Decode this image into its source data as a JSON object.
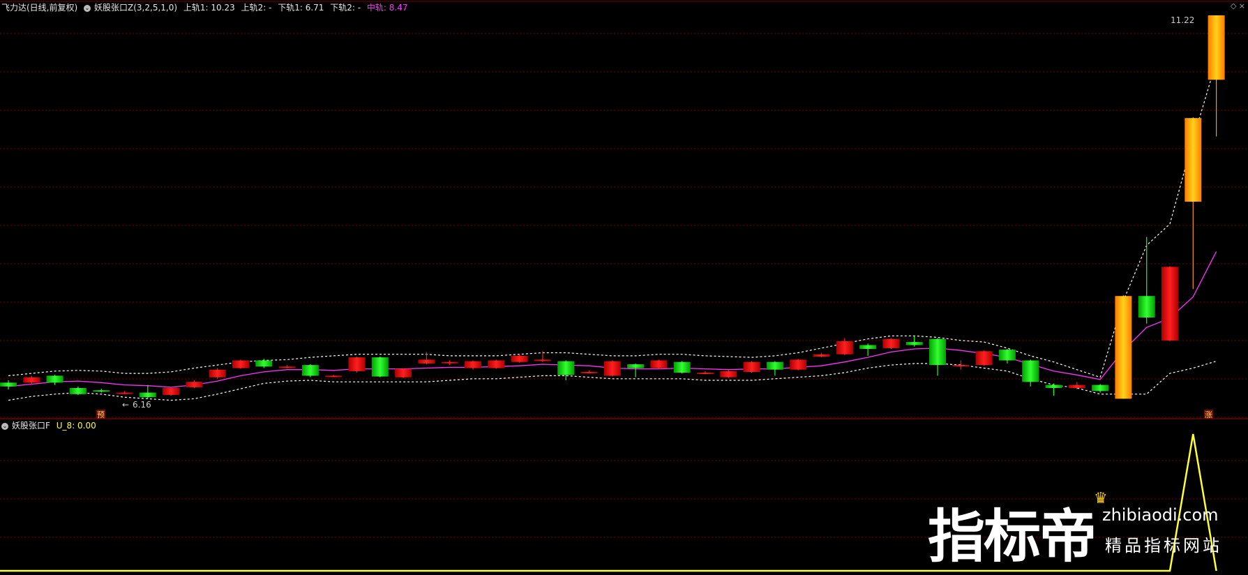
{
  "main_header": {
    "stock_name": "飞力达(日线,前复权)",
    "indicator_name": "妖股张口Z(3,2,5,1,0)",
    "upper1": "上轨1: 10.23",
    "upper2": "上轨2: -",
    "lower1": "下轨1: 6.71",
    "lower2": "下轨2: -",
    "mid": "中轨: 8.47"
  },
  "sub_header": {
    "indicator_name": "妖股张口F",
    "value": "U_8: 0.00"
  },
  "annotations": {
    "high_label": "11.22",
    "low_label": "6.16",
    "marker_left": "预",
    "marker_right": "涨"
  },
  "watermark": {
    "brand": "指标帝",
    "url": "zhibiaodi.com",
    "tagline": "精品指标网站"
  },
  "colors": {
    "up": "#ff1a1a",
    "down": "#1aff1a",
    "highlight": "#ff9900",
    "mid_line": "#ff33ff",
    "band_line": "#ffffff",
    "sub_line": "#ffff33",
    "grid": "#7a0000"
  },
  "chart_data": {
    "type": "candlestick",
    "price_range": [
      6.0,
      11.3
    ],
    "candles": [
      {
        "o": 6.43,
        "c": 6.38,
        "h": 6.46,
        "l": 6.34,
        "d": "down"
      },
      {
        "o": 6.43,
        "c": 6.5,
        "h": 6.52,
        "l": 6.4,
        "d": "up"
      },
      {
        "o": 6.43,
        "c": 6.52,
        "h": 6.53,
        "l": 6.4,
        "d": "down"
      },
      {
        "o": 6.36,
        "c": 6.28,
        "h": 6.38,
        "l": 6.27,
        "d": "down"
      },
      {
        "o": 6.33,
        "c": 6.33,
        "h": 6.35,
        "l": 6.3,
        "d": "down"
      },
      {
        "o": 6.3,
        "c": 6.3,
        "h": 6.32,
        "l": 6.28,
        "d": "up"
      },
      {
        "o": 6.3,
        "c": 6.24,
        "h": 6.4,
        "l": 6.22,
        "d": "down"
      },
      {
        "o": 6.27,
        "c": 6.36,
        "h": 6.37,
        "l": 6.26,
        "d": "up"
      },
      {
        "o": 6.37,
        "c": 6.44,
        "h": 6.46,
        "l": 6.36,
        "d": "up"
      },
      {
        "o": 6.5,
        "c": 6.6,
        "h": 6.62,
        "l": 6.48,
        "d": "up"
      },
      {
        "o": 6.62,
        "c": 6.72,
        "h": 6.73,
        "l": 6.61,
        "d": "up"
      },
      {
        "o": 6.72,
        "c": 6.64,
        "h": 6.74,
        "l": 6.62,
        "d": "down"
      },
      {
        "o": 6.64,
        "c": 6.64,
        "h": 6.66,
        "l": 6.62,
        "d": "up"
      },
      {
        "o": 6.66,
        "c": 6.52,
        "h": 6.67,
        "l": 6.5,
        "d": "down"
      },
      {
        "o": 6.52,
        "c": 6.52,
        "h": 6.53,
        "l": 6.51,
        "d": "up"
      },
      {
        "o": 6.58,
        "c": 6.76,
        "h": 6.77,
        "l": 6.56,
        "d": "up"
      },
      {
        "o": 6.76,
        "c": 6.51,
        "h": 6.77,
        "l": 6.5,
        "d": "down"
      },
      {
        "o": 6.5,
        "c": 6.61,
        "h": 6.62,
        "l": 6.49,
        "d": "up"
      },
      {
        "o": 6.68,
        "c": 6.73,
        "h": 6.83,
        "l": 6.67,
        "d": "up"
      },
      {
        "o": 6.7,
        "c": 6.7,
        "h": 6.72,
        "l": 6.66,
        "d": "up"
      },
      {
        "o": 6.62,
        "c": 6.71,
        "h": 6.72,
        "l": 6.6,
        "d": "up"
      },
      {
        "o": 6.62,
        "c": 6.72,
        "h": 6.73,
        "l": 6.61,
        "d": "up"
      },
      {
        "o": 6.7,
        "c": 6.78,
        "h": 6.8,
        "l": 6.69,
        "d": "up"
      },
      {
        "o": 6.73,
        "c": 6.73,
        "h": 6.84,
        "l": 6.7,
        "d": "up"
      },
      {
        "o": 6.71,
        "c": 6.53,
        "h": 6.72,
        "l": 6.46,
        "d": "down"
      },
      {
        "o": 6.57,
        "c": 6.57,
        "h": 6.59,
        "l": 6.55,
        "d": "up"
      },
      {
        "o": 6.52,
        "c": 6.71,
        "h": 6.72,
        "l": 6.51,
        "d": "up"
      },
      {
        "o": 6.67,
        "c": 6.62,
        "h": 6.68,
        "l": 6.5,
        "d": "down"
      },
      {
        "o": 6.62,
        "c": 6.72,
        "h": 6.73,
        "l": 6.61,
        "d": "up"
      },
      {
        "o": 6.7,
        "c": 6.56,
        "h": 6.71,
        "l": 6.55,
        "d": "down"
      },
      {
        "o": 6.56,
        "c": 6.56,
        "h": 6.58,
        "l": 6.54,
        "d": "up"
      },
      {
        "o": 6.5,
        "c": 6.58,
        "h": 6.59,
        "l": 6.49,
        "d": "up"
      },
      {
        "o": 6.57,
        "c": 6.7,
        "h": 6.71,
        "l": 6.56,
        "d": "up"
      },
      {
        "o": 6.7,
        "c": 6.6,
        "h": 6.71,
        "l": 6.52,
        "d": "down"
      },
      {
        "o": 6.6,
        "c": 6.73,
        "h": 6.74,
        "l": 6.59,
        "d": "up"
      },
      {
        "o": 6.77,
        "c": 6.8,
        "h": 6.82,
        "l": 6.76,
        "d": "up"
      },
      {
        "o": 6.8,
        "c": 6.97,
        "h": 7.01,
        "l": 6.79,
        "d": "up"
      },
      {
        "o": 6.87,
        "c": 6.92,
        "h": 6.94,
        "l": 6.78,
        "d": "down"
      },
      {
        "o": 6.88,
        "c": 7.0,
        "h": 7.01,
        "l": 6.87,
        "d": "up"
      },
      {
        "o": 6.96,
        "c": 6.92,
        "h": 7.04,
        "l": 6.9,
        "d": "down"
      },
      {
        "o": 7.0,
        "c": 6.66,
        "h": 7.01,
        "l": 6.52,
        "d": "down"
      },
      {
        "o": 6.66,
        "c": 6.66,
        "h": 6.72,
        "l": 6.6,
        "d": "up"
      },
      {
        "o": 6.66,
        "c": 6.84,
        "h": 6.85,
        "l": 6.65,
        "d": "up"
      },
      {
        "o": 6.86,
        "c": 6.72,
        "h": 6.87,
        "l": 6.68,
        "d": "down"
      },
      {
        "o": 6.72,
        "c": 6.44,
        "h": 6.73,
        "l": 6.38,
        "d": "down"
      },
      {
        "o": 6.4,
        "c": 6.36,
        "h": 6.42,
        "l": 6.26,
        "d": "down"
      },
      {
        "o": 6.36,
        "c": 6.4,
        "h": 6.44,
        "l": 6.34,
        "d": "up"
      },
      {
        "o": 6.4,
        "c": 6.32,
        "h": 6.41,
        "l": 6.3,
        "d": "down"
      },
      {
        "o": 6.22,
        "c": 7.56,
        "h": 7.57,
        "l": 6.22,
        "d": "hi"
      },
      {
        "o": 7.28,
        "c": 7.56,
        "h": 8.33,
        "l": 7.2,
        "d": "down"
      },
      {
        "o": 6.98,
        "c": 7.94,
        "h": 7.95,
        "l": 6.97,
        "d": "up"
      },
      {
        "o": 8.79,
        "c": 9.88,
        "h": 9.89,
        "l": 7.65,
        "d": "hi"
      },
      {
        "o": 10.38,
        "c": 11.22,
        "h": 11.22,
        "l": 9.64,
        "d": "hi"
      }
    ],
    "mid_line": [
      6.38,
      6.41,
      6.44,
      6.45,
      6.43,
      6.4,
      6.39,
      6.37,
      6.4,
      6.45,
      6.52,
      6.57,
      6.6,
      6.6,
      6.59,
      6.61,
      6.61,
      6.61,
      6.62,
      6.63,
      6.63,
      6.64,
      6.65,
      6.67,
      6.66,
      6.65,
      6.62,
      6.61,
      6.61,
      6.62,
      6.61,
      6.6,
      6.61,
      6.61,
      6.63,
      6.65,
      6.7,
      6.76,
      6.83,
      6.87,
      6.88,
      6.85,
      6.81,
      6.76,
      6.67,
      6.58,
      6.53,
      6.47,
      6.85,
      7.15,
      7.27,
      7.55,
      8.14
    ],
    "upper_band": [
      6.52,
      6.55,
      6.58,
      6.59,
      6.58,
      6.55,
      6.55,
      6.57,
      6.62,
      6.66,
      6.7,
      6.72,
      6.73,
      6.76,
      6.78,
      6.8,
      6.8,
      6.8,
      6.8,
      6.78,
      6.78,
      6.78,
      6.8,
      6.82,
      6.82,
      6.8,
      6.78,
      6.78,
      6.8,
      6.8,
      6.78,
      6.77,
      6.76,
      6.78,
      6.82,
      6.88,
      6.94,
      7.0,
      7.04,
      7.04,
      7.02,
      6.98,
      6.96,
      6.88,
      6.78,
      6.7,
      6.6,
      6.5,
      7.5,
      8.22,
      8.5,
      9.6,
      10.62
    ],
    "lower_band": [
      6.2,
      6.25,
      6.28,
      6.3,
      6.28,
      6.24,
      6.22,
      6.2,
      6.22,
      6.28,
      6.35,
      6.42,
      6.45,
      6.46,
      6.44,
      6.44,
      6.44,
      6.44,
      6.44,
      6.46,
      6.48,
      6.48,
      6.5,
      6.52,
      6.52,
      6.5,
      6.48,
      6.48,
      6.48,
      6.48,
      6.46,
      6.46,
      6.46,
      6.48,
      6.5,
      6.52,
      6.56,
      6.62,
      6.66,
      6.68,
      6.68,
      6.66,
      6.62,
      6.58,
      6.48,
      6.4,
      6.36,
      6.28,
      6.28,
      6.28,
      6.55,
      6.62,
      6.71
    ],
    "sub_series": [
      0,
      0,
      0,
      0,
      0,
      0,
      0,
      0,
      0,
      0,
      0,
      0,
      0,
      0,
      0,
      0,
      0,
      0,
      0,
      0,
      0,
      0,
      0,
      0,
      0,
      0,
      0,
      0,
      0,
      0,
      0,
      0,
      0,
      0,
      0,
      0,
      0,
      0,
      0,
      0,
      0,
      0,
      0,
      0,
      0,
      0,
      0,
      0,
      0,
      0,
      0,
      1,
      0
    ]
  }
}
